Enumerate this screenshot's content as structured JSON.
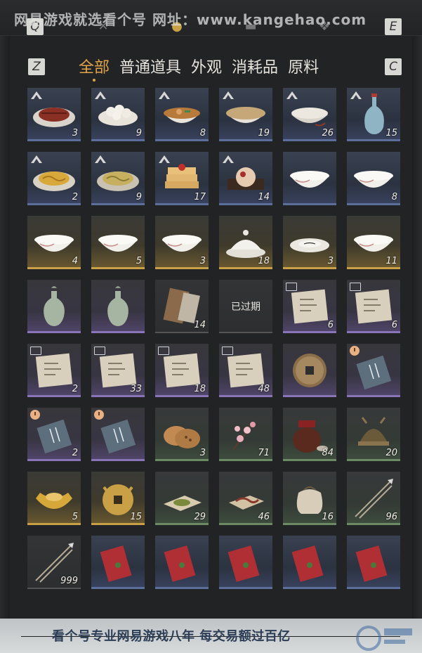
{
  "watermark_top": "网易游戏就选看个号  网址：www.kangehao.com",
  "watermark_bottom": "看个号专业网易游戏八年 每交易额过百亿",
  "keys": {
    "left": "Z",
    "right": "C",
    "top_left": "Q",
    "top_right": "E"
  },
  "tabs": [
    {
      "label": "全部",
      "active": true
    },
    {
      "label": "普通道具",
      "active": false
    },
    {
      "label": "外观",
      "active": false
    },
    {
      "label": "消耗品",
      "active": false
    },
    {
      "label": "原料",
      "active": false
    }
  ],
  "items": [
    {
      "name": "roast-meat",
      "icon": "plate-meat",
      "qty": "3",
      "rarity": "blue",
      "badge": "tier"
    },
    {
      "name": "dumplings",
      "icon": "bowl-dumplings",
      "qty": "9",
      "rarity": "blue",
      "badge": "tier"
    },
    {
      "name": "noodle-soup",
      "icon": "bowl-soup",
      "qty": "8",
      "rarity": "blue",
      "badge": "tier"
    },
    {
      "name": "congee",
      "icon": "bowl-congee",
      "qty": "19",
      "rarity": "blue",
      "badge": "tier"
    },
    {
      "name": "rice-bowl",
      "icon": "bowl-rice",
      "qty": "26",
      "rarity": "blue",
      "badge": "tier"
    },
    {
      "name": "wine-vase",
      "icon": "vase-blue",
      "qty": "15",
      "rarity": "blue",
      "badge": "tier"
    },
    {
      "name": "fried-noodles",
      "icon": "plate-noodles",
      "qty": "2",
      "rarity": "blue",
      "badge": "tier"
    },
    {
      "name": "plain-noodles",
      "icon": "plate-noodles2",
      "qty": "9",
      "rarity": "blue",
      "badge": "tier"
    },
    {
      "name": "pancakes",
      "icon": "stack-cakes",
      "qty": "17",
      "rarity": "blue",
      "badge": "tier"
    },
    {
      "name": "cake-plate",
      "icon": "plate-cake",
      "qty": "14",
      "rarity": "blue",
      "badge": "tier"
    },
    {
      "name": "porcelain-bowl-pink",
      "icon": "bowl-white",
      "qty": "",
      "rarity": "blue",
      "badge": ""
    },
    {
      "name": "porcelain-bowl-flower",
      "icon": "bowl-white",
      "qty": "8",
      "rarity": "blue",
      "badge": ""
    },
    {
      "name": "porcelain-bowl-color",
      "icon": "bowl-white",
      "qty": "4",
      "rarity": "gold",
      "badge": ""
    },
    {
      "name": "porcelain-bowl-rooster",
      "icon": "bowl-white",
      "qty": "5",
      "rarity": "gold",
      "badge": ""
    },
    {
      "name": "porcelain-bowl-ink",
      "icon": "bowl-white",
      "qty": "3",
      "rarity": "gold",
      "badge": ""
    },
    {
      "name": "covered-bowl",
      "icon": "bowl-covered",
      "qty": "18",
      "rarity": "gold",
      "badge": ""
    },
    {
      "name": "porcelain-dish",
      "icon": "dish",
      "qty": "3",
      "rarity": "gold",
      "badge": ""
    },
    {
      "name": "porcelain-bowl-blue",
      "icon": "bowl-white",
      "qty": "11",
      "rarity": "gold",
      "badge": ""
    },
    {
      "name": "celadon-vase",
      "icon": "vase-green",
      "qty": "",
      "rarity": "purple",
      "badge": ""
    },
    {
      "name": "celadon-vase-2",
      "icon": "vase-green",
      "qty": "",
      "rarity": "purple",
      "badge": ""
    },
    {
      "name": "wooden-plaque",
      "icon": "plaque",
      "qty": "14",
      "rarity": "dark",
      "badge": ""
    },
    {
      "name": "expired-item",
      "icon": "none",
      "qty": "",
      "rarity": "dark",
      "badge": "",
      "label": "已过期"
    },
    {
      "name": "paper-scroll-1",
      "icon": "paper",
      "qty": "6",
      "rarity": "purple",
      "badge": "book"
    },
    {
      "name": "paper-scroll-2",
      "icon": "paper",
      "qty": "6",
      "rarity": "purple",
      "badge": "book"
    },
    {
      "name": "paper-scroll-3",
      "icon": "paper",
      "qty": "2",
      "rarity": "purple",
      "badge": "book"
    },
    {
      "name": "paper-scroll-4",
      "icon": "paper",
      "qty": "33",
      "rarity": "purple",
      "badge": "book"
    },
    {
      "name": "paper-scroll-5",
      "icon": "paper",
      "qty": "18",
      "rarity": "purple",
      "badge": "book"
    },
    {
      "name": "paper-scroll-6",
      "icon": "paper",
      "qty": "48",
      "rarity": "purple",
      "badge": "book"
    },
    {
      "name": "copper-coin",
      "icon": "coin",
      "qty": "",
      "rarity": "purple",
      "badge": ""
    },
    {
      "name": "talisman-1",
      "icon": "talisman",
      "qty": "",
      "rarity": "purple",
      "badge": "clock"
    },
    {
      "name": "talisman-2",
      "icon": "talisman",
      "qty": "2",
      "rarity": "purple",
      "badge": "clock"
    },
    {
      "name": "talisman-3",
      "icon": "talisman",
      "qty": "",
      "rarity": "purple",
      "badge": "clock"
    },
    {
      "name": "flatbread",
      "icon": "bread",
      "qty": "3",
      "rarity": "green",
      "badge": ""
    },
    {
      "name": "plum-blossom",
      "icon": "blossom",
      "qty": "71",
      "rarity": "green",
      "badge": ""
    },
    {
      "name": "wine-jar",
      "icon": "jar",
      "qty": "84",
      "rarity": "green",
      "badge": ""
    },
    {
      "name": "iron-helmet",
      "icon": "helmet",
      "qty": "20",
      "rarity": "green",
      "badge": ""
    },
    {
      "name": "gold-ingot",
      "icon": "ingot",
      "qty": "5",
      "rarity": "gold",
      "badge": ""
    },
    {
      "name": "cat-coin",
      "icon": "catcoin",
      "qty": "15",
      "rarity": "gold",
      "badge": ""
    },
    {
      "name": "herb-powder",
      "icon": "powder",
      "qty": "29",
      "rarity": "green",
      "badge": ""
    },
    {
      "name": "earthworm",
      "icon": "worm",
      "qty": "46",
      "rarity": "green",
      "badge": ""
    },
    {
      "name": "cloth-sack",
      "icon": "sack",
      "qty": "16",
      "rarity": "green",
      "badge": ""
    },
    {
      "name": "arrows",
      "icon": "arrows",
      "qty": "96",
      "rarity": "green",
      "badge": ""
    },
    {
      "name": "arrows-2",
      "icon": "arrows",
      "qty": "999",
      "rarity": "dark",
      "badge": ""
    },
    {
      "name": "red-envelope-1",
      "icon": "envelope",
      "qty": "",
      "rarity": "blue",
      "badge": ""
    },
    {
      "name": "red-envelope-2",
      "icon": "envelope",
      "qty": "",
      "rarity": "blue",
      "badge": ""
    },
    {
      "name": "red-envelope-3",
      "icon": "envelope",
      "qty": "",
      "rarity": "blue",
      "badge": ""
    },
    {
      "name": "red-envelope-4",
      "icon": "envelope",
      "qty": "",
      "rarity": "blue",
      "badge": ""
    },
    {
      "name": "red-envelope-5",
      "icon": "envelope",
      "qty": "",
      "rarity": "blue",
      "badge": ""
    }
  ]
}
